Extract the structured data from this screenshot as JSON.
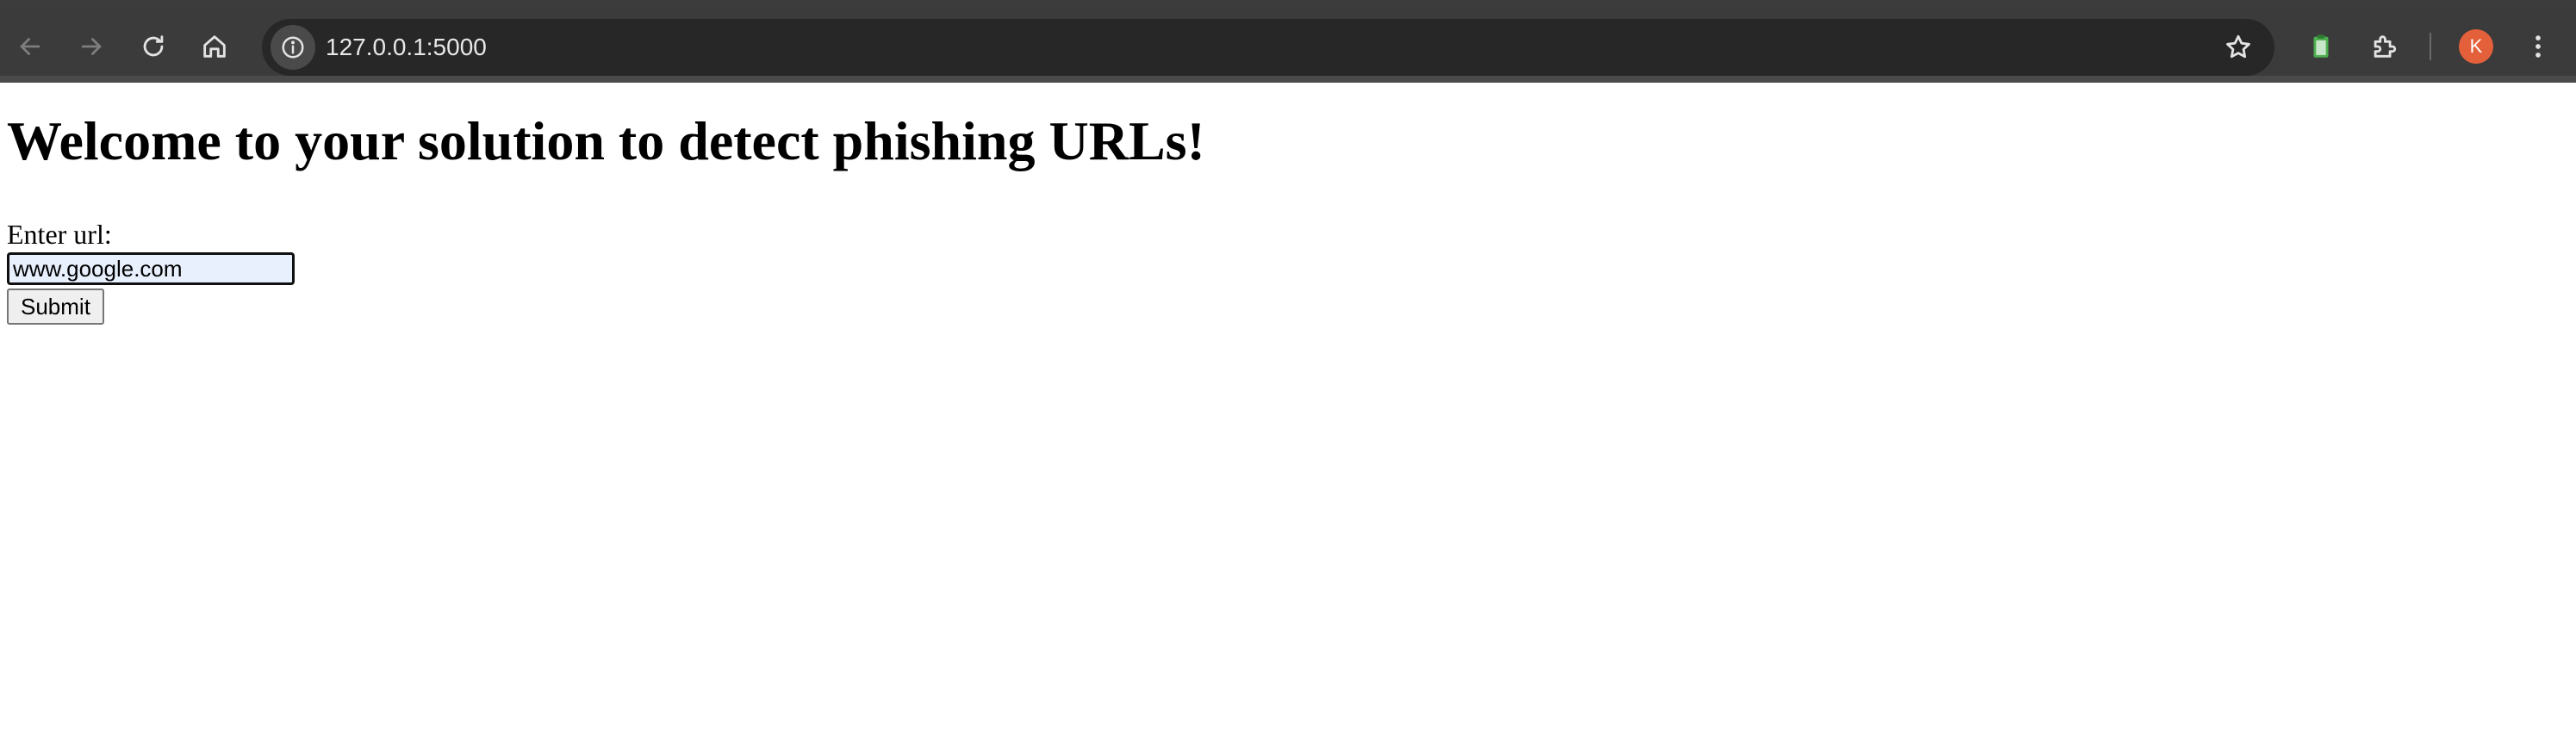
{
  "browser": {
    "url": "127.0.0.1:5000",
    "profile_initial": "K",
    "icons": {
      "back": "back-arrow-icon",
      "forward": "forward-arrow-icon",
      "reload": "reload-icon",
      "home": "home-icon",
      "site_info": "info-icon",
      "bookmark": "star-icon",
      "clipboard_extension": "clipboard-icon",
      "extensions": "puzzle-piece-icon",
      "menu": "kebab-menu-icon"
    },
    "colors": {
      "chrome_bg": "#3b3b3b",
      "omnibox_bg": "#272727",
      "avatar_bg": "#e4603a",
      "extension_green": "#4caf50"
    }
  },
  "page": {
    "heading": "Welcome to your solution to detect phishing URLs!",
    "form": {
      "label": "Enter url:",
      "input_value": "www.google.com",
      "submit_label": "Submit"
    }
  }
}
